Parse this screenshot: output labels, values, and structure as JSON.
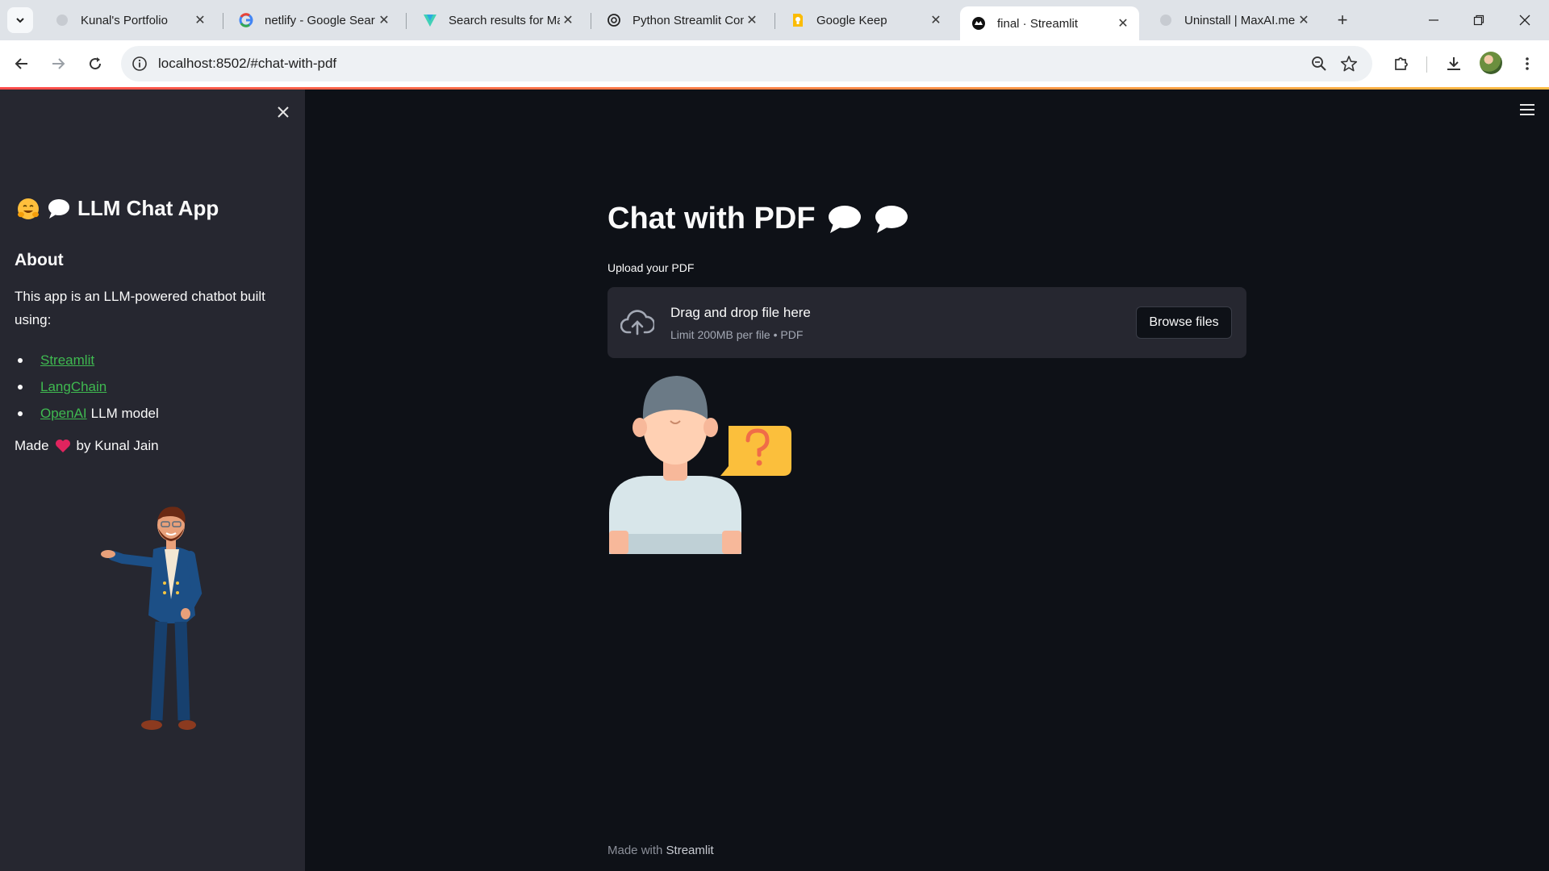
{
  "browser": {
    "tabs": [
      {
        "title": "Kunal's Portfolio",
        "icon": "globe-icon"
      },
      {
        "title": "netlify - Google Sear",
        "icon": "google-icon"
      },
      {
        "title": "Search results for Ma",
        "icon": "vite-icon"
      },
      {
        "title": "Python Streamlit Con",
        "icon": "openai-icon"
      },
      {
        "title": "Google Keep",
        "icon": "keep-icon"
      },
      {
        "title": "final · Streamlit",
        "icon": "streamlit-icon",
        "active": true
      },
      {
        "title": "Uninstall | MaxAI.me",
        "icon": "globe-icon"
      }
    ],
    "new_tab_label": "+",
    "tab_close_label": "✕",
    "url": "localhost:8502/#chat-with-pdf"
  },
  "sidebar": {
    "close_label": "✕",
    "app_title": "LLM Chat App",
    "about_heading": "About",
    "description": "This app is an LLM-powered chatbot built using:",
    "links": [
      {
        "text": "Streamlit",
        "after": ""
      },
      {
        "text": "LangChain",
        "after": ""
      },
      {
        "text": "OpenAI",
        "after": "LLM model"
      }
    ],
    "made_prefix": "Made",
    "made_suffix": "by Kunal Jain"
  },
  "main": {
    "title": "Chat with PDF",
    "upload_label": "Upload your PDF",
    "dropzone_main": "Drag and drop file here",
    "dropzone_sub": "Limit 200MB per file • PDF",
    "browse_label": "Browse files",
    "footer_prefix": "Made with",
    "footer_brand": "Streamlit"
  },
  "colors": {
    "app_bg": "#0e1117",
    "sidebar_bg": "#262730",
    "link": "#3fb950",
    "accent_bar": "#ff4b4b"
  }
}
